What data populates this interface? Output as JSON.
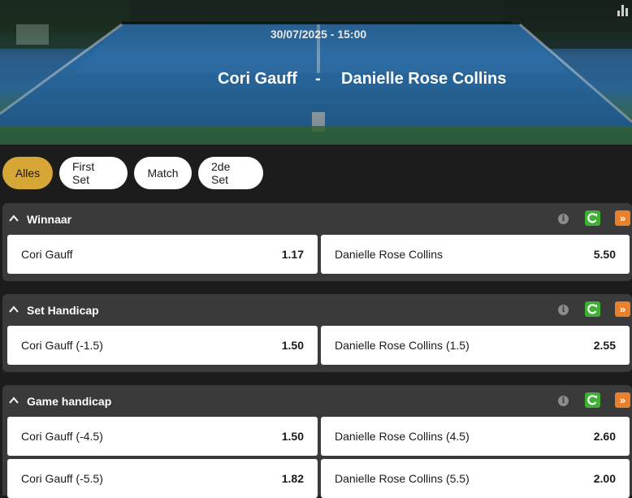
{
  "event": {
    "datetime": "30/07/2025 - 15:00",
    "player1": "Cori Gauff",
    "separator": "-",
    "player2": "Danielle Rose Collins"
  },
  "tabs": [
    {
      "label": "Alles",
      "active": true
    },
    {
      "label": "First Set",
      "active": false
    },
    {
      "label": "Match",
      "active": false
    },
    {
      "label": "2de Set",
      "active": false
    }
  ],
  "markets": [
    {
      "title": "Winnaar",
      "rows": [
        {
          "left": {
            "name": "Cori Gauff",
            "odds": "1.17"
          },
          "right": {
            "name": "Danielle Rose Collins",
            "odds": "5.50"
          }
        }
      ]
    },
    {
      "title": "Set Handicap",
      "rows": [
        {
          "left": {
            "name": "Cori Gauff (-1.5)",
            "odds": "1.50"
          },
          "right": {
            "name": "Danielle Rose Collins (1.5)",
            "odds": "2.55"
          }
        }
      ]
    },
    {
      "title": "Game handicap",
      "rows": [
        {
          "left": {
            "name": "Cori Gauff (-4.5)",
            "odds": "1.50"
          },
          "right": {
            "name": "Danielle Rose Collins (4.5)",
            "odds": "2.60"
          }
        },
        {
          "left": {
            "name": "Cori Gauff (-5.5)",
            "odds": "1.82"
          },
          "right": {
            "name": "Danielle Rose Collins (5.5)",
            "odds": "2.00"
          }
        }
      ]
    }
  ],
  "icons": {
    "collapse": "chevron-up-icon",
    "info": "info-icon",
    "cashout": "refresh-icon",
    "expand": "double-chevron-right-icon",
    "stats": "bar-chart-icon"
  },
  "colors": {
    "active_tab": "#d6a636",
    "cashout_green": "#3fb035",
    "expand_orange": "#e9812b",
    "panel": "#3a3a3a"
  }
}
